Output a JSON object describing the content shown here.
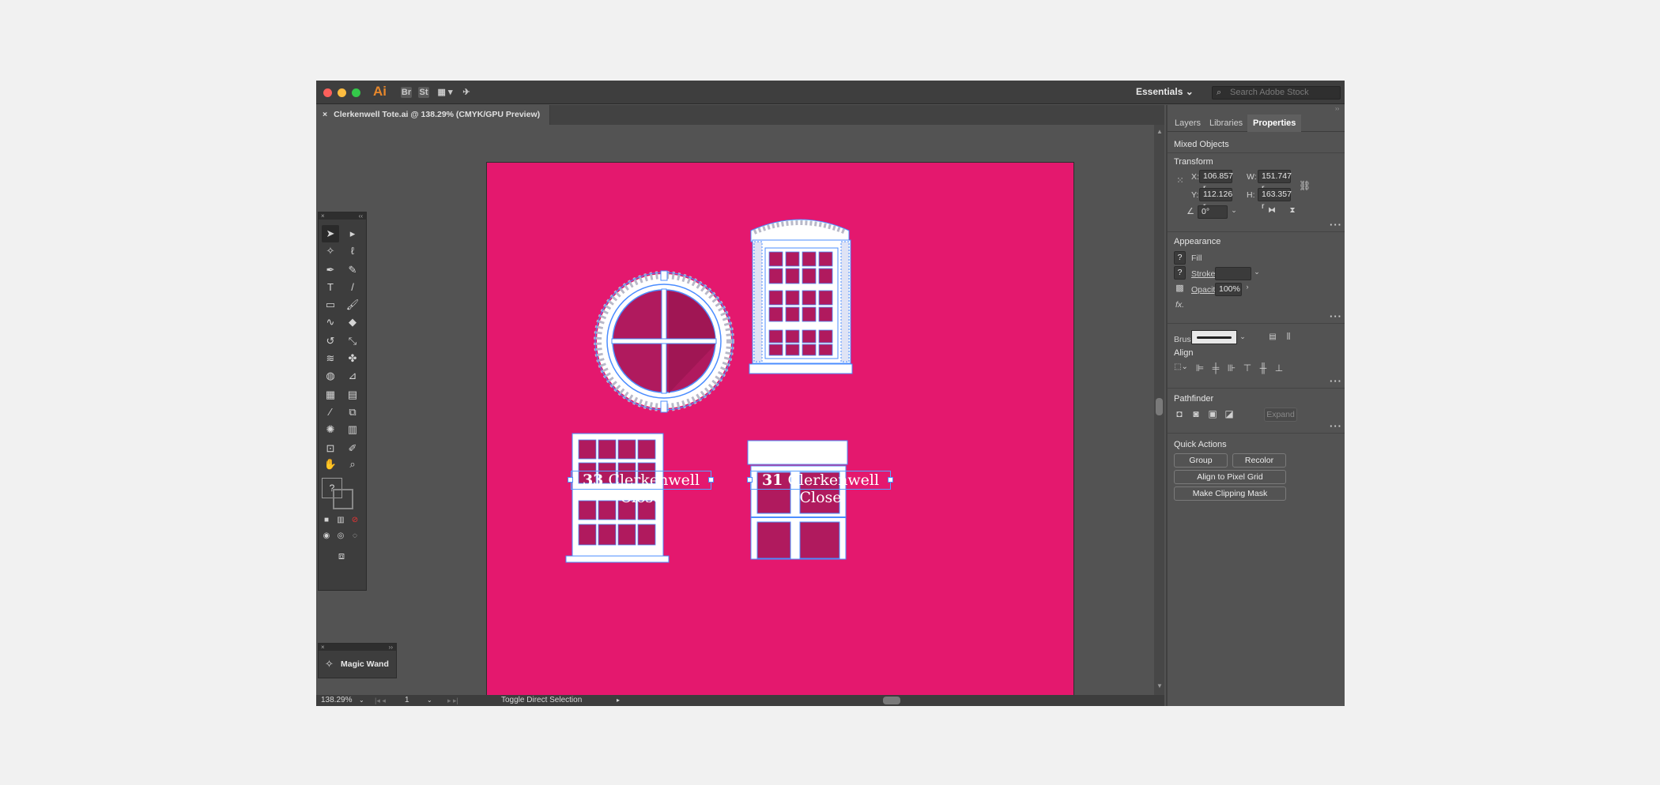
{
  "window": {
    "app_logo": "Ai",
    "workspace": "Essentials",
    "search_placeholder": "Search Adobe Stock",
    "icons": {
      "bridge": "Br",
      "stock": "St"
    }
  },
  "document": {
    "tab_title": "Clerkenwell Tote.ai @ 138.29% (CMYK/GPU Preview)",
    "close": "×"
  },
  "artboard": {
    "color": "#e4186e",
    "labels": [
      {
        "number": "33",
        "street": "Clerkenwell Close"
      },
      {
        "number": "31",
        "street": "Clerkenwell Close"
      }
    ]
  },
  "tools_panel": {
    "magic_wand_label": "Magic Wand",
    "unknown_fill": "?"
  },
  "status": {
    "zoom": "138.29%",
    "artboard_number": "1",
    "tool_hint": "Toggle Direct Selection"
  },
  "panels": {
    "tabs": [
      "Layers",
      "Libraries",
      "Properties"
    ],
    "active_tab": "Properties",
    "selection_type": "Mixed Objects",
    "transform": {
      "title": "Transform",
      "x_label": "X:",
      "x": "106.857 r",
      "y_label": "Y:",
      "y": "112.126 r",
      "w_label": "W:",
      "w": "151.747 r",
      "h_label": "H:",
      "h": "163.357 r",
      "angle": "0°"
    },
    "appearance": {
      "title": "Appearance",
      "fill_label": "Fill",
      "stroke_label": "Stroke",
      "opacity_label": "Opacity",
      "opacity": "100%",
      "fx": "fx.",
      "unknown": "?"
    },
    "brush_label": "Brush",
    "align_title": "Align",
    "pathfinder": {
      "title": "Pathfinder",
      "expand": "Expand"
    },
    "quick_actions": {
      "title": "Quick Actions",
      "group": "Group",
      "recolor": "Recolor",
      "align_pixel": "Align to Pixel Grid",
      "clipping_mask": "Make Clipping Mask"
    }
  }
}
